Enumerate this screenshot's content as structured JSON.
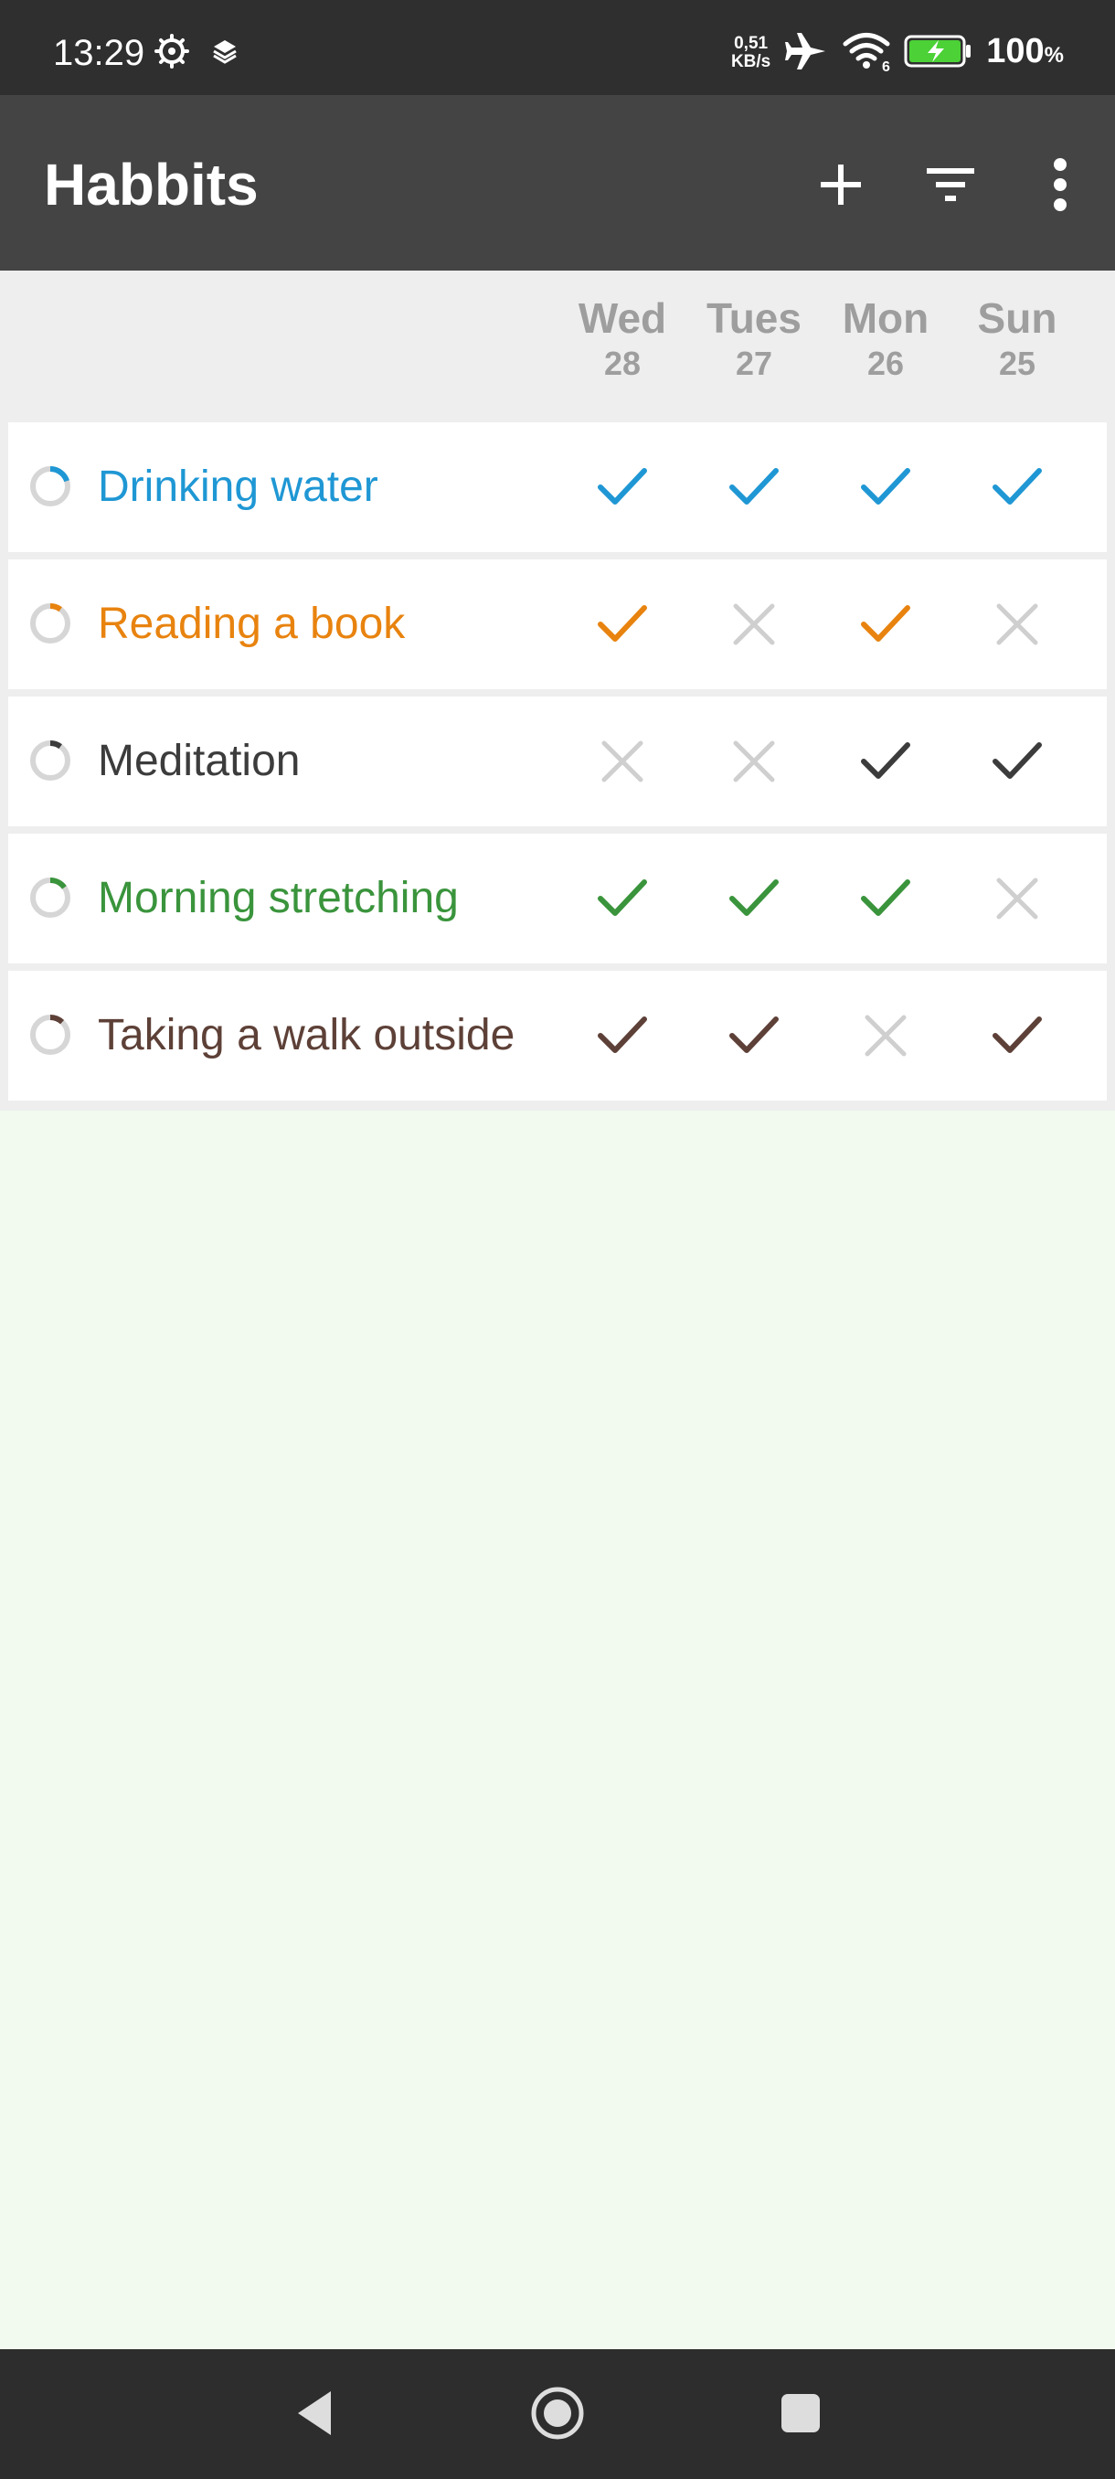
{
  "status_bar": {
    "time": "13:29",
    "net_speed_value": "0,51",
    "net_speed_unit": "KB/s",
    "wifi_badge": "6",
    "battery_percent": "100",
    "battery_unit": "%",
    "icons": [
      "gear-icon",
      "layers-icon",
      "airplane-icon",
      "wifi-icon",
      "battery-charging-icon"
    ]
  },
  "app_bar": {
    "title": "Habbits",
    "actions": [
      "add-icon",
      "filter-icon",
      "more-vert-icon"
    ]
  },
  "days": [
    {
      "name": "Wed",
      "number": "28"
    },
    {
      "name": "Tues",
      "number": "27"
    },
    {
      "name": "Mon",
      "number": "26"
    },
    {
      "name": "Sun",
      "number": "25"
    }
  ],
  "habits": [
    {
      "name": "Drinking water",
      "color": "#1f97d4",
      "progress": 0.2,
      "marks": [
        true,
        true,
        true,
        true
      ]
    },
    {
      "name": "Reading a book",
      "color": "#e8830f",
      "progress": 0.1,
      "marks": [
        true,
        false,
        true,
        false
      ]
    },
    {
      "name": "Meditation",
      "color": "#3c3c3c",
      "progress": 0.1,
      "marks": [
        false,
        false,
        true,
        true
      ]
    },
    {
      "name": "Morning stretching",
      "color": "#3a943c",
      "progress": 0.15,
      "marks": [
        true,
        true,
        true,
        false
      ]
    },
    {
      "name": "Taking a walk outside",
      "color": "#5d4037",
      "progress": 0.12,
      "marks": [
        true,
        true,
        false,
        true
      ]
    }
  ],
  "colors": {
    "status_bar_bg": "#2f2f2f",
    "app_bar_bg": "#444444",
    "header_bg": "#eeeeee",
    "unchecked": "#cfcfcf",
    "ring_track": "#d6d6d6",
    "content_bg": "#f2f9ef",
    "nav_bar_bg": "#2d2d2d"
  },
  "nav_bar": {
    "buttons": [
      "back-icon",
      "home-icon",
      "recents-icon"
    ]
  }
}
